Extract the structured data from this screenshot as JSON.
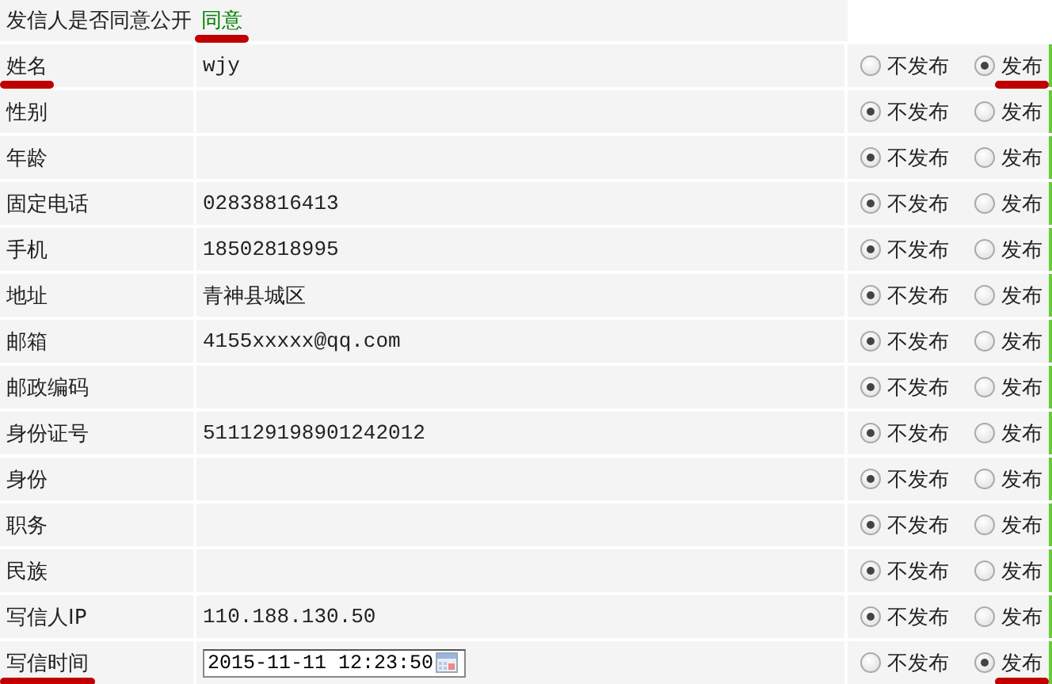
{
  "consent": {
    "label": "发信人是否同意公开",
    "value": "同意",
    "value_underlined": true
  },
  "rows": [
    {
      "label": "姓名",
      "label_underlined": true,
      "kind": "text",
      "value": "wjy",
      "options": [
        {
          "label": "不发布",
          "selected": false,
          "underlined": false
        },
        {
          "label": "发布",
          "selected": true,
          "underlined": true
        }
      ]
    },
    {
      "label": "性别",
      "label_underlined": false,
      "kind": "text",
      "options": [
        {
          "label": "不发布",
          "selected": true,
          "underlined": false
        },
        {
          "label": "发布",
          "selected": false,
          "underlined": false
        }
      ]
    },
    {
      "label": "年龄",
      "label_underlined": false,
      "kind": "text",
      "options": [
        {
          "label": "不发布",
          "selected": true,
          "underlined": false
        },
        {
          "label": "发布",
          "selected": false,
          "underlined": false
        }
      ]
    },
    {
      "label": "固定电话",
      "label_underlined": false,
      "kind": "text",
      "value": "02838816413",
      "options": [
        {
          "label": "不发布",
          "selected": true,
          "underlined": false
        },
        {
          "label": "发布",
          "selected": false,
          "underlined": false
        }
      ]
    },
    {
      "label": "手机",
      "label_underlined": false,
      "kind": "text",
      "value": "18502818995",
      "options": [
        {
          "label": "不发布",
          "selected": true,
          "underlined": false
        },
        {
          "label": "发布",
          "selected": false,
          "underlined": false
        }
      ]
    },
    {
      "label": "地址",
      "label_underlined": false,
      "kind": "text",
      "value": "青神县城区",
      "options": [
        {
          "label": "不发布",
          "selected": true,
          "underlined": false
        },
        {
          "label": "发布",
          "selected": false,
          "underlined": false
        }
      ]
    },
    {
      "label": "邮箱",
      "label_underlined": false,
      "kind": "text",
      "value": "4155xxxxx@qq.com",
      "options": [
        {
          "label": "不发布",
          "selected": true,
          "underlined": false
        },
        {
          "label": "发布",
          "selected": false,
          "underlined": false
        }
      ]
    },
    {
      "label": "邮政编码",
      "label_underlined": false,
      "kind": "text",
      "options": [
        {
          "label": "不发布",
          "selected": true,
          "underlined": false
        },
        {
          "label": "发布",
          "selected": false,
          "underlined": false
        }
      ]
    },
    {
      "label": "身份证号",
      "label_underlined": false,
      "kind": "text",
      "value": "511129198901242012",
      "options": [
        {
          "label": "不发布",
          "selected": true,
          "underlined": false
        },
        {
          "label": "发布",
          "selected": false,
          "underlined": false
        }
      ]
    },
    {
      "label": "身份",
      "label_underlined": false,
      "kind": "text",
      "options": [
        {
          "label": "不发布",
          "selected": true,
          "underlined": false
        },
        {
          "label": "发布",
          "selected": false,
          "underlined": false
        }
      ]
    },
    {
      "label": "职务",
      "label_underlined": false,
      "kind": "text",
      "options": [
        {
          "label": "不发布",
          "selected": true,
          "underlined": false
        },
        {
          "label": "发布",
          "selected": false,
          "underlined": false
        }
      ]
    },
    {
      "label": "民族",
      "label_underlined": false,
      "kind": "text",
      "options": [
        {
          "label": "不发布",
          "selected": true,
          "underlined": false
        },
        {
          "label": "发布",
          "selected": false,
          "underlined": false
        }
      ]
    },
    {
      "label": "写信人IP",
      "label_underlined": false,
      "kind": "text",
      "value": "110.188.130.50",
      "options": [
        {
          "label": "不发布",
          "selected": true,
          "underlined": false
        },
        {
          "label": "发布",
          "selected": false,
          "underlined": false
        }
      ]
    },
    {
      "label": "写信时间",
      "label_underlined": true,
      "kind": "datetime",
      "value": "2015-11-11 12:23:50",
      "options": [
        {
          "label": "不发布",
          "selected": false,
          "underlined": false
        },
        {
          "label": "发布",
          "selected": true,
          "underlined": true
        }
      ]
    }
  ]
}
